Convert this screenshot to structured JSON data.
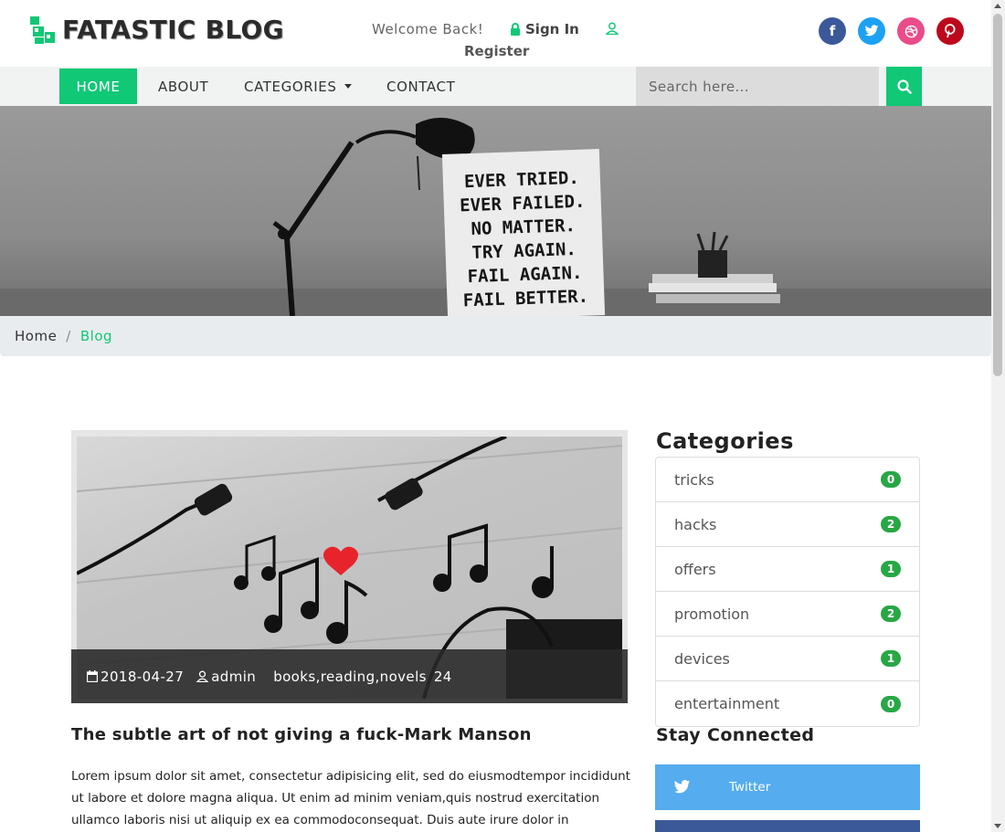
{
  "header": {
    "logo_text": "FATASTIC BLOG",
    "welcome": "Welcome Back!",
    "sign_in": "Sign In",
    "register": "Register",
    "social": [
      "facebook-icon",
      "twitter-icon",
      "dribbble-icon",
      "pinterest-icon"
    ]
  },
  "nav": {
    "home": "HOME",
    "about": "ABOUT",
    "categories": "CATEGORIES",
    "contact": "CONTACT",
    "search_placeholder": "Search here..."
  },
  "hero": {
    "poster_lines": [
      "EVER TRIED.",
      "EVER FAILED.",
      "NO MATTER.",
      "TRY AGAIN.",
      "FAIL AGAIN.",
      "FAIL BETTER."
    ]
  },
  "breadcrumb": {
    "home": "Home",
    "current": "Blog"
  },
  "post": {
    "date": "2018-04-27",
    "author": "admin",
    "tags": "books,reading,novels",
    "count": "24",
    "title": "The subtle art of not giving a fuck-Mark Manson",
    "body": "Lorem ipsum dolor sit amet, consectetur adipisicing elit, sed do eiusmodtempor incididunt ut labore et dolore magna aliqua. Ut enim ad minim veniam,quis nostrud exercitation ullamco laboris nisi ut aliquip ex ea commodoconsequat. Duis aute irure dolor in"
  },
  "sidebar": {
    "categories_title": "Categories",
    "categories": [
      {
        "name": "tricks",
        "count": "0"
      },
      {
        "name": "hacks",
        "count": "2"
      },
      {
        "name": "offers",
        "count": "1"
      },
      {
        "name": "promotion",
        "count": "2"
      },
      {
        "name": "devices",
        "count": "1"
      },
      {
        "name": "entertainment",
        "count": "0"
      }
    ],
    "stay_connected": "Stay Connected",
    "twitter_label": "Twitter"
  },
  "colors": {
    "accent": "#10c875",
    "badge": "#28a745",
    "twitter": "#55acee",
    "facebook": "#3b5998"
  }
}
